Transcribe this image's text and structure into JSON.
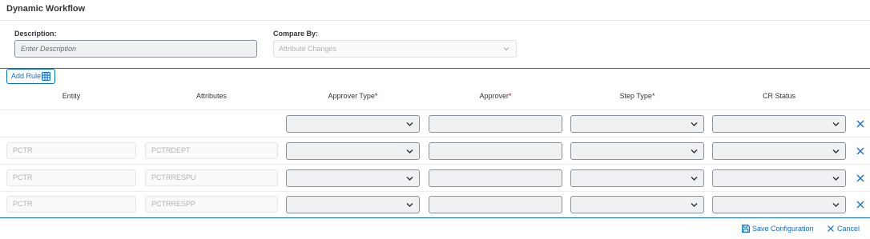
{
  "header": {
    "title": "Dynamic Workflow"
  },
  "form": {
    "description_label": "Description:",
    "description_placeholder": "Enter Description",
    "compare_label": "Compare By:",
    "compare_value": "Attribute Changes"
  },
  "toolbar": {
    "add_rule_label": "Add Rule"
  },
  "table": {
    "columns": {
      "entity": "Entity",
      "attributes": "Attributes",
      "approver_type": "Approver Type",
      "approver": "Approver",
      "step_type": "Step Type",
      "cr_status": "CR Status"
    },
    "required_marker": "*",
    "rows": [
      {
        "entity": "",
        "attributes": ""
      },
      {
        "entity": "PCTR",
        "attributes": "PCTRDEPT"
      },
      {
        "entity": "PCTR",
        "attributes": "PCTRRESPU"
      },
      {
        "entity": "PCTR",
        "attributes": "PCTRRESPP"
      }
    ]
  },
  "footer": {
    "save_label": "Save Configuration",
    "cancel_label": "Cancel"
  },
  "colors": {
    "accent": "#0a6ed1",
    "required": "#bb0000",
    "field_bg": "#eff1f2"
  }
}
